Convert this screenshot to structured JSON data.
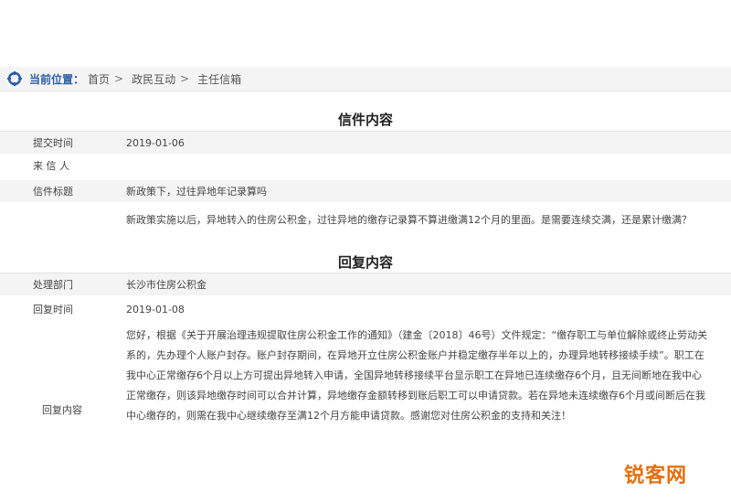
{
  "breadcrumb": {
    "label": "当前位置：",
    "items": [
      "首页",
      "政民互动",
      "主任信箱"
    ],
    "separator": ">"
  },
  "letter": {
    "section_title": "信件内容",
    "submit_time_label": "提交时间",
    "submit_time": "2019-01-06",
    "sender_label": "来 信 人",
    "sender": "",
    "subject_label": "信件标题",
    "subject": "新政策下，过往异地年记录算吗",
    "content": "新政策实施以后，异地转入的住房公积金，过往异地的缴存记录算不算进缴满12个月的里面。是需要连续交满，还是累计缴满？"
  },
  "reply": {
    "section_title": "回复内容",
    "dept_label": "处理部门",
    "dept": "长沙市住房公积金",
    "time_label": "回复时间",
    "time": "2019-01-08",
    "content_label": "回复内容",
    "content": "您好，根据《关于开展治理违规提取住房公积金工作的通知》（建金〔2018〕46号）文件规定：“缴存职工与单位解除或终止劳动关系的，先办理个人账户封存。账户封存期间，在异地开立住房公积金账户并稳定缴存半年以上的，办理异地转移接续手续”。职工在我中心正常缴存6个月以上方可提出异地转入申请，全国异地转移接续平台显示职工在异地已连续缴存6个月，且无间断地在我中心正常缴存，则该异地缴存时间可以合并计算，异地缴存金额转移到账后职工可以申请贷款。若在异地未连续缴存6个月或间断后在我中心缴存的，则需在我中心继续缴存至满12个月方能申请贷款。感谢您对住房公积金的支持和关注！"
  },
  "watermark": "锐客网",
  "colors": {
    "accent": "#2a5da6",
    "shade": "#f4f4f4",
    "watermark": "#e46f0e"
  }
}
